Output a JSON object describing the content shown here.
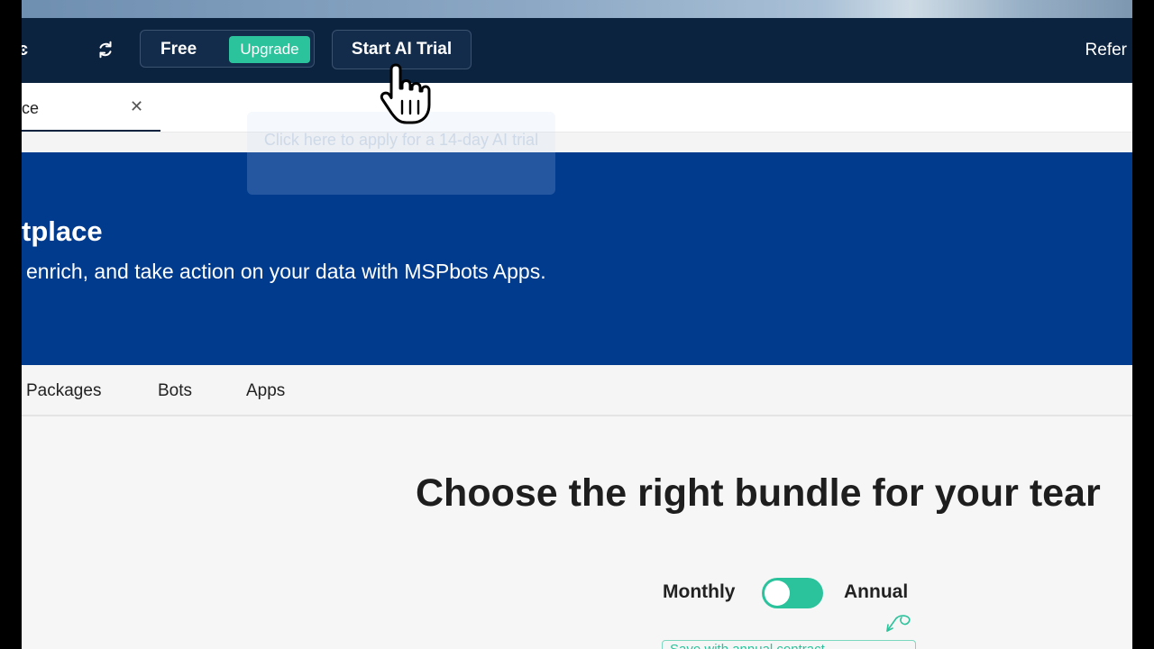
{
  "topbar": {
    "brand_fragment": "ͼ",
    "plan_label": "Free",
    "upgrade_label": "Upgrade",
    "trial_label": "Start AI Trial",
    "refer_label": "Refer",
    "colors": {
      "bar": "#0c2340",
      "accent": "#2bc39c"
    }
  },
  "tabbar": {
    "active_tab_label": "ce"
  },
  "tooltip": {
    "text": "Click here to apply for a 14-day AI trial"
  },
  "hero": {
    "title": "tplace",
    "subtitle": "enrich, and take action on your data with MSPbots Apps.",
    "background": "#003b8e"
  },
  "subnav": {
    "items": [
      "Packages",
      "Bots",
      "Apps"
    ]
  },
  "main": {
    "heading": "Choose the right bundle for your tear",
    "billing": {
      "monthly_label": "Monthly",
      "annual_label": "Annual",
      "toggle_state": "monthly",
      "note_text": "Save with annual contract"
    }
  },
  "icons": [
    "refresh-icon",
    "close-icon",
    "pointer-cursor-icon",
    "arrow-squiggle-icon"
  ]
}
